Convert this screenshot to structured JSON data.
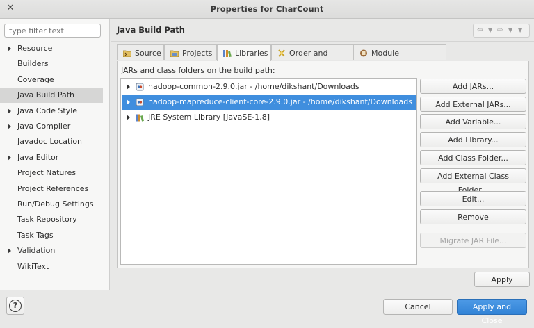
{
  "window": {
    "title": "Properties for CharCount",
    "close_icon": "close-icon"
  },
  "filter": {
    "placeholder": "type filter text",
    "value": ""
  },
  "nav": {
    "items": [
      {
        "label": "Resource",
        "expandable": true
      },
      {
        "label": "Builders",
        "expandable": false
      },
      {
        "label": "Coverage",
        "expandable": false
      },
      {
        "label": "Java Build Path",
        "expandable": false,
        "selected": true
      },
      {
        "label": "Java Code Style",
        "expandable": true
      },
      {
        "label": "Java Compiler",
        "expandable": true
      },
      {
        "label": "Javadoc Location",
        "expandable": false
      },
      {
        "label": "Java Editor",
        "expandable": true
      },
      {
        "label": "Project Natures",
        "expandable": false
      },
      {
        "label": "Project References",
        "expandable": false
      },
      {
        "label": "Run/Debug Settings",
        "expandable": false
      },
      {
        "label": "Task Repository",
        "expandable": false
      },
      {
        "label": "Task Tags",
        "expandable": false
      },
      {
        "label": "Validation",
        "expandable": true
      },
      {
        "label": "WikiText",
        "expandable": false
      }
    ]
  },
  "page": {
    "title": "Java Build Path"
  },
  "tabs": [
    {
      "label": "Source",
      "icon": "source-folder-icon"
    },
    {
      "label": "Projects",
      "icon": "projects-icon"
    },
    {
      "label": "Libraries",
      "icon": "libraries-icon",
      "active": true
    },
    {
      "label": "Order and Export",
      "icon": "order-export-icon"
    },
    {
      "label": "Module Dependencies",
      "icon": "module-icon"
    }
  ],
  "libraries": {
    "label": "JARs and class folders on the build path:",
    "entries": [
      {
        "label": "hadoop-common-2.9.0.jar - /home/dikshant/Downloads",
        "icon": "jar-icon"
      },
      {
        "label": "hadoop-mapreduce-client-core-2.9.0.jar - /home/dikshant/Downloads",
        "icon": "jar-icon",
        "selected": true
      },
      {
        "label": "JRE System Library [JavaSE-1.8]",
        "icon": "library-icon"
      }
    ]
  },
  "buttons": {
    "add_jars": "Add JARs...",
    "add_external_jars": "Add External JARs...",
    "add_variable": "Add Variable...",
    "add_library": "Add Library...",
    "add_class_folder": "Add Class Folder...",
    "add_external_class_folder": "Add External Class Folder...",
    "edit": "Edit...",
    "remove": "Remove",
    "migrate_jar": "Migrate JAR File...",
    "apply": "Apply",
    "cancel": "Cancel",
    "apply_and_close": "Apply and Close"
  },
  "help": {
    "label": "?"
  },
  "colors": {
    "selection": "#3f8ede",
    "primary_button": "#3283d6"
  }
}
